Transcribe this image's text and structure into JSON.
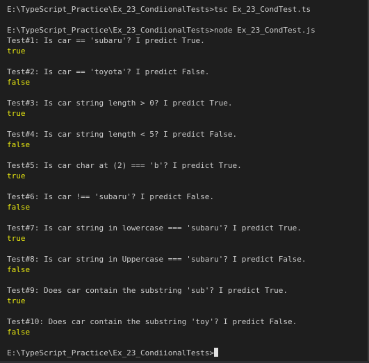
{
  "colors": {
    "background": "#1e1e1e",
    "text": "#cccccc",
    "result": "#e5e510",
    "cursor": "#e0e0e0"
  },
  "terminal": {
    "command1": "E:\\TypeScript_Practice\\Ex_23_CondiionalTests>tsc Ex_23_CondTest.ts",
    "command2": "E:\\TypeScript_Practice\\Ex_23_CondiionalTests>node Ex_23_CondTest.js",
    "tests": [
      {
        "line": "Test#1: Is car == 'subaru'? I predict True.",
        "result": "true"
      },
      {
        "line": "Test#2: Is car == 'toyota'? I predict False.",
        "result": "false"
      },
      {
        "line": "Test#3: Is car string length > 0? I predict True.",
        "result": "true"
      },
      {
        "line": "Test#4: Is car string length < 5? I predict False.",
        "result": "false"
      },
      {
        "line": "Test#5: Is car char at (2) === 'b'? I predict True.",
        "result": "true"
      },
      {
        "line": "Test#6: Is car !== 'subaru'? I predict False.",
        "result": "false"
      },
      {
        "line": "Test#7: Is car string in lowercase === 'subaru'? I predict True.",
        "result": "true"
      },
      {
        "line": "Test#8: Is car string in Uppercase === 'subaru'? I predict False.",
        "result": "false"
      },
      {
        "line": "Test#9: Does car contain the substring 'sub'? I predict True.",
        "result": "true"
      },
      {
        "line": "Test#10: Does car contain the substring 'toy'? I predict False.",
        "result": "false"
      }
    ],
    "prompt": "E:\\TypeScript_Practice\\Ex_23_CondiionalTests>"
  }
}
